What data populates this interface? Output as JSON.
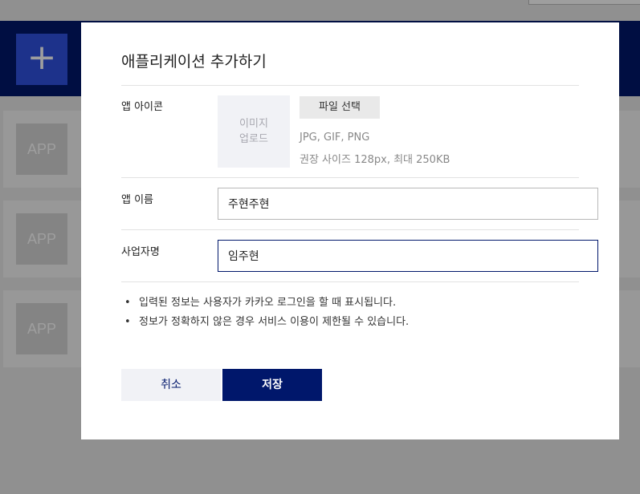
{
  "background": {
    "plus_label": "+",
    "app_tiles": [
      "APP",
      "APP",
      "APP"
    ]
  },
  "modal": {
    "title": "애플리케이션 추가하기",
    "icon_section": {
      "label": "앱 아이콘",
      "placeholder_line1": "이미지",
      "placeholder_line2": "업로드",
      "file_button": "파일 선택",
      "formats": "JPG, GIF, PNG",
      "size_hint": "권장 사이즈 128px, 최대 250KB"
    },
    "app_name": {
      "label": "앱 이름",
      "value": "주현주현"
    },
    "company_name": {
      "label": "사업자명",
      "value": "임주현"
    },
    "notes": [
      "입력된 정보는 사용자가 카카오 로그인을 할 때 표시됩니다.",
      "정보가 정확하지 않은 경우 서비스 이용이 제한될 수 있습니다."
    ],
    "cancel_button": "취소",
    "save_button": "저장"
  },
  "colors": {
    "brand_navy": "#00176b",
    "accent_blue": "#2f51e0"
  }
}
